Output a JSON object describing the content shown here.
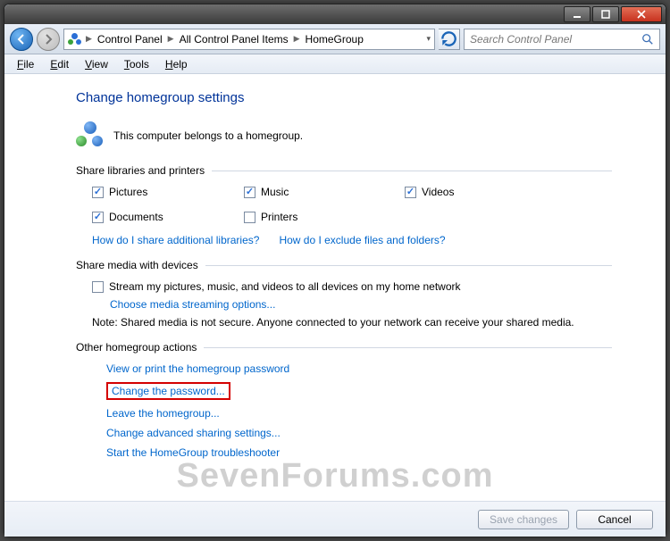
{
  "titlebar": {
    "min_tooltip": "Minimize",
    "max_tooltip": "Maximize",
    "close_tooltip": "Close"
  },
  "address": {
    "seg1": "Control Panel",
    "seg2": "All Control Panel Items",
    "seg3": "HomeGroup"
  },
  "search": {
    "placeholder": "Search Control Panel"
  },
  "menus": {
    "file": "File",
    "edit": "Edit",
    "view": "View",
    "tools": "Tools",
    "help": "Help"
  },
  "page": {
    "heading": "Change homegroup settings",
    "belongs": "This computer belongs to a homegroup.",
    "section_share": "Share libraries and printers",
    "checks": {
      "pictures": "Pictures",
      "music": "Music",
      "videos": "Videos",
      "documents": "Documents",
      "printers": "Printers"
    },
    "link_share_libs": "How do I share additional libraries?",
    "link_exclude": "How do I exclude files and folders?",
    "section_media": "Share media with devices",
    "stream_check": "Stream my pictures, music, and videos to all devices on my home network",
    "link_streaming": "Choose media streaming options...",
    "note": "Note: Shared media is not secure. Anyone connected to your network can receive your shared media.",
    "section_actions": "Other homegroup actions",
    "action_view_pw": "View or print the homegroup password",
    "action_change_pw": "Change the password...",
    "action_leave": "Leave the homegroup...",
    "action_adv": "Change advanced sharing settings...",
    "action_tshoot": "Start the HomeGroup troubleshooter"
  },
  "footer": {
    "save": "Save changes",
    "cancel": "Cancel"
  },
  "watermark": "SevenForums.com"
}
